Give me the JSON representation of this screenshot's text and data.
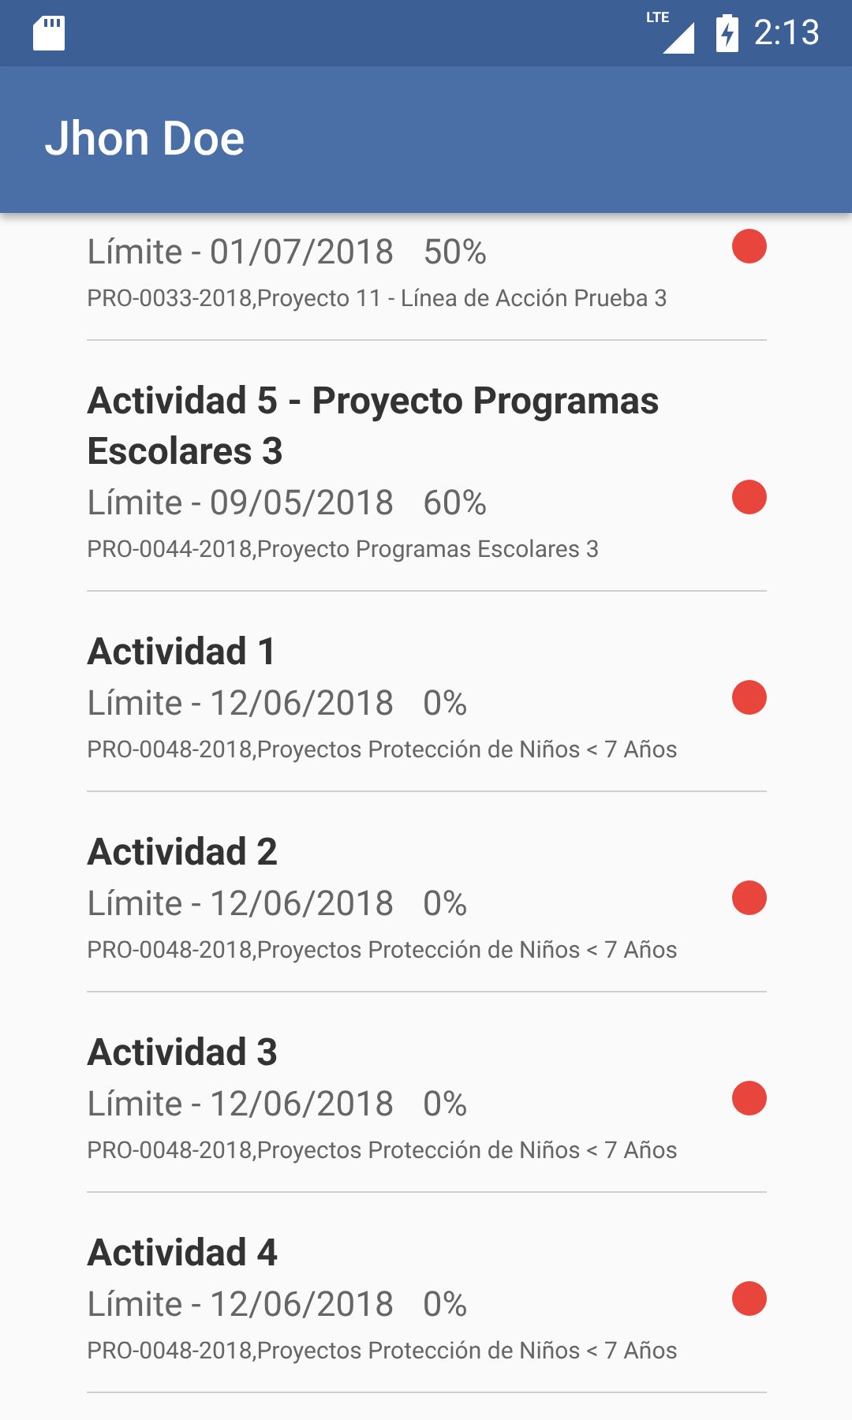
{
  "status_bar": {
    "network": "LTE",
    "time": "2:13"
  },
  "app_bar": {
    "title": "Jhon Doe"
  },
  "activities": [
    {
      "limit": "Límite - 01/07/2018",
      "progress": "50%",
      "project": "PRO-0033-2018,Proyecto 11 - Línea de Acción Prueba 3",
      "color": "#e8453c"
    },
    {
      "title": "Actividad 5 - Proyecto Programas Escolares 3",
      "limit": "Límite - 09/05/2018",
      "progress": "60%",
      "project": "PRO-0044-2018,Proyecto Programas Escolares 3",
      "color": "#e8453c"
    },
    {
      "title": "Actividad 1",
      "limit": "Límite - 12/06/2018",
      "progress": "0%",
      "project": "PRO-0048-2018,Proyectos Protección de Niños < 7 Años",
      "color": "#e8453c"
    },
    {
      "title": "Actividad 2",
      "limit": "Límite - 12/06/2018",
      "progress": "0%",
      "project": "PRO-0048-2018,Proyectos Protección de Niños < 7 Años",
      "color": "#e8453c"
    },
    {
      "title": "Actividad 3",
      "limit": "Límite - 12/06/2018",
      "progress": "0%",
      "project": "PRO-0048-2018,Proyectos Protección de Niños < 7 Años",
      "color": "#e8453c"
    },
    {
      "title": "Actividad 4",
      "limit": "Límite - 12/06/2018",
      "progress": "0%",
      "project": "PRO-0048-2018,Proyectos Protección de Niños < 7 Años",
      "color": "#e8453c"
    }
  ]
}
